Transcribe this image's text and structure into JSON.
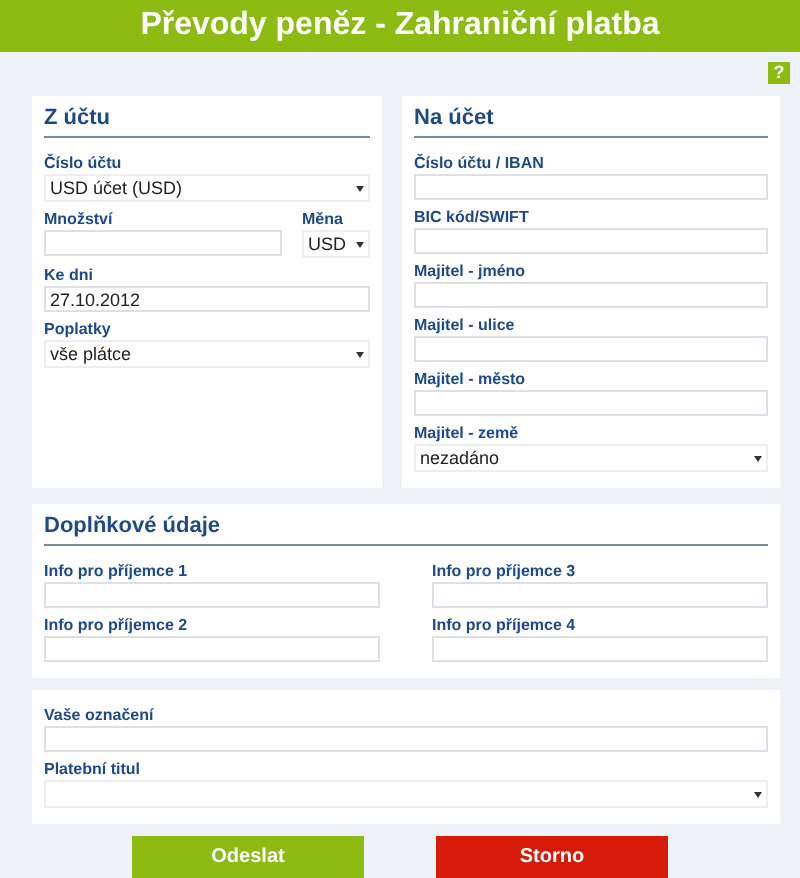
{
  "title": "Převody peněz - Zahraniční platba",
  "help": {
    "label": "?"
  },
  "from_account": {
    "heading": "Z účtu",
    "rows": [
      [
        {
          "label": "Číslo účtu",
          "kind": "select",
          "value": "USD účet (USD)"
        }
      ],
      [
        {
          "label": "Množství",
          "kind": "text"
        },
        {
          "label": "Měna",
          "kind": "select",
          "value": "USD"
        }
      ],
      [
        {
          "label": "Ke dni",
          "kind": "text",
          "value": "27.10.2012"
        }
      ],
      [
        {
          "label": "Poplatky",
          "kind": "select",
          "value": "vše plátce"
        }
      ]
    ]
  },
  "to_account": {
    "heading": "Na účet",
    "rows": [
      [
        {
          "label": "Číslo účtu / IBAN",
          "kind": "text"
        }
      ],
      [
        {
          "label": "BIC kód/SWIFT",
          "kind": "text"
        }
      ],
      [
        {
          "label": "Majitel - jméno",
          "kind": "text"
        }
      ],
      [
        {
          "label": "Majitel - ulice",
          "kind": "text"
        }
      ],
      [
        {
          "label": "Majitel - město",
          "kind": "text"
        }
      ],
      [
        {
          "label": "Majitel - země",
          "kind": "select",
          "value": "nezadáno"
        }
      ]
    ]
  },
  "additional": {
    "heading": "Doplňkové údaje",
    "rows": [
      [
        {
          "label": "Info pro příjemce 1",
          "kind": "text"
        },
        {
          "label": "Info pro příjemce 3",
          "kind": "text"
        }
      ],
      [
        {
          "label": "Info pro příjemce 2",
          "kind": "text"
        },
        {
          "label": "Info pro příjemce 4",
          "kind": "text"
        }
      ]
    ]
  },
  "reference": {
    "rows": [
      [
        {
          "label": "Vaše označení",
          "kind": "text"
        }
      ],
      [
        {
          "label": "Platební titul",
          "kind": "select"
        }
      ]
    ]
  },
  "buttons": [
    {
      "label": "Odeslat",
      "kind": "submit"
    },
    {
      "label": "Storno",
      "kind": "cancel"
    }
  ]
}
